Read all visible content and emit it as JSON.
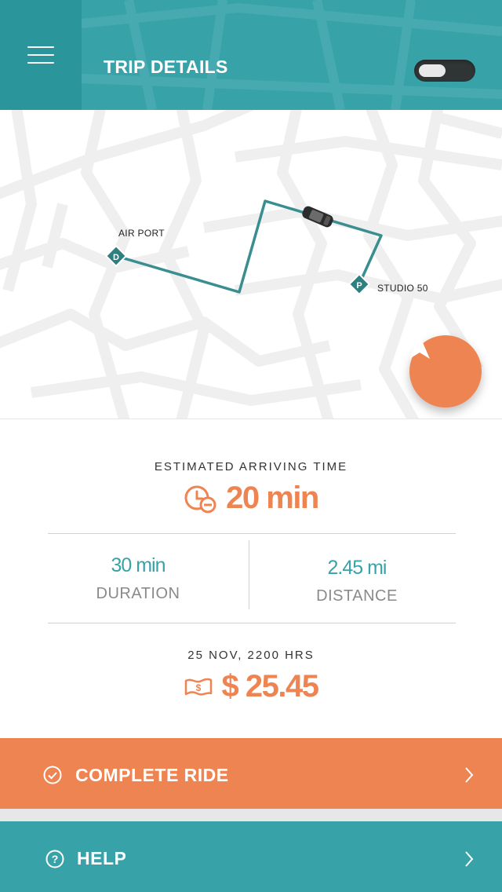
{
  "header": {
    "title": "TRIP DETAILS",
    "menu_icon": "hamburger-menu-icon",
    "toggle_state": "off"
  },
  "map": {
    "origin_label": "AIR PORT",
    "destination_label": "STUDIO 50",
    "origin_marker_letter": "D",
    "destination_marker_letter": "P",
    "route_color": "#3a8e90",
    "navigate_icon": "navigation-arrow-icon"
  },
  "eta": {
    "label": "ESTIMATED ARRIVING TIME",
    "value": "20 min",
    "icon": "clock-minus-icon"
  },
  "stats": {
    "duration_value": "30 min",
    "duration_label": "DURATION",
    "distance_value": "2.45 mi",
    "distance_label": "DISTANCE"
  },
  "fare": {
    "date_label": "25 NOV, 2200 HRS",
    "amount": "$ 25.45",
    "icon": "cash-icon"
  },
  "actions": {
    "complete_label": "COMPLETE RIDE",
    "complete_icon": "check-circle-icon",
    "help_label": "HELP",
    "help_icon": "question-circle-icon"
  },
  "colors": {
    "teal": "#37a3a9",
    "teal_dark": "#2a969b",
    "orange": "#ee8451"
  }
}
